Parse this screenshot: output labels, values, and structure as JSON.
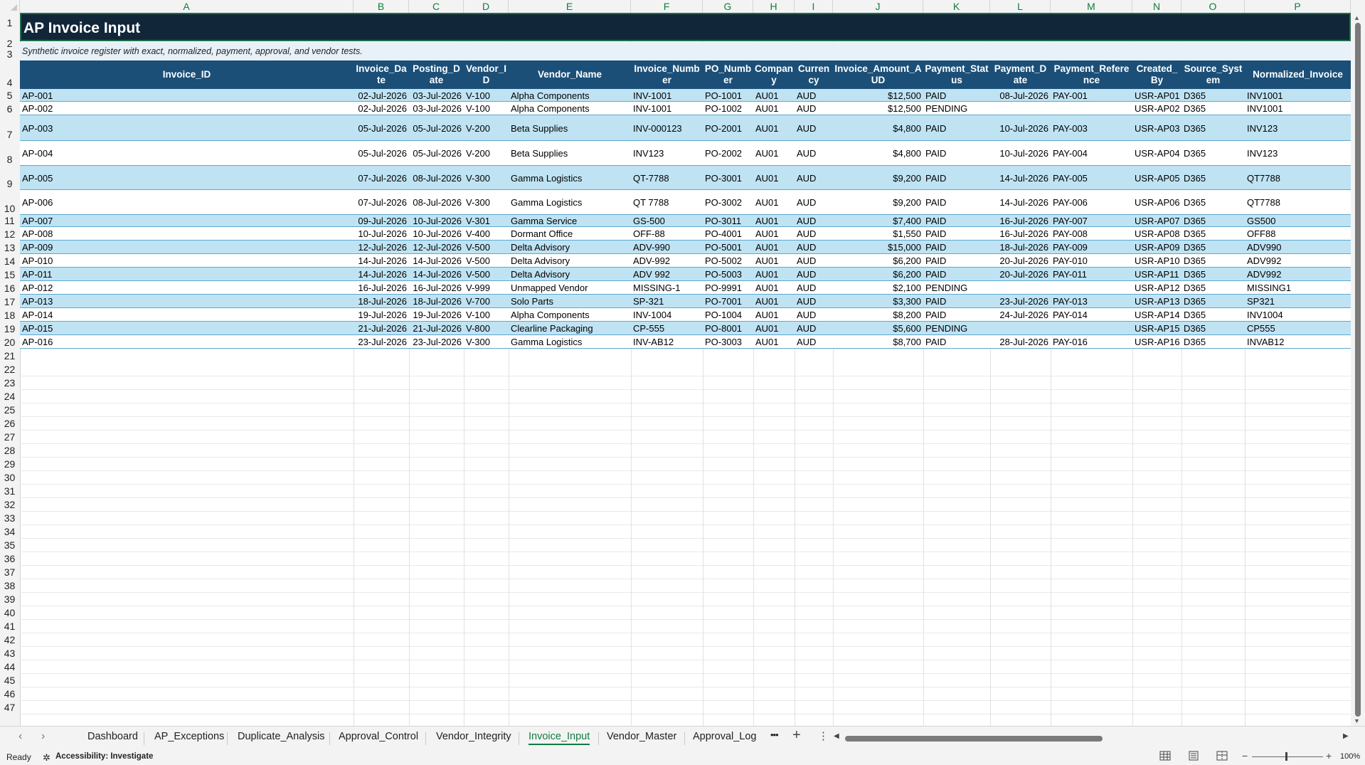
{
  "sheet": {
    "title": "AP Invoice Input",
    "subtitle": "Synthetic invoice register with exact, normalized, payment, approval, and vendor tests."
  },
  "column_letters": [
    "A",
    "B",
    "C",
    "D",
    "E",
    "F",
    "G",
    "H",
    "I",
    "J",
    "K",
    "L",
    "M",
    "N",
    "O",
    "P"
  ],
  "row_numbers": [
    "1",
    "2",
    "3",
    "4",
    "5",
    "6",
    "7",
    "8",
    "9",
    "10",
    "11",
    "12",
    "13",
    "14",
    "15",
    "16",
    "17",
    "18",
    "19",
    "20",
    "21",
    "22",
    "23",
    "24",
    "25",
    "26",
    "27",
    "28",
    "29",
    "30",
    "31",
    "32",
    "33",
    "34",
    "35",
    "36",
    "37",
    "38",
    "39",
    "40",
    "41",
    "42",
    "43",
    "44",
    "45",
    "46",
    "47"
  ],
  "table": {
    "headers": [
      "Invoice_ID",
      "Invoice_Date",
      "Posting_Date",
      "Vendor_ID",
      "Vendor_Name",
      "Invoice_Number",
      "PO_Number",
      "Company",
      "Currency",
      "Invoice_Amount_AUD",
      "Payment_Status",
      "Payment_Date",
      "Payment_Reference",
      "Created_By",
      "Source_System",
      "Normalized_Invoice"
    ],
    "rows": [
      [
        "AP-001",
        "02-Jul-2026",
        "03-Jul-2026",
        "V-100",
        "Alpha Components",
        "INV-1001",
        "PO-1001",
        "AU01",
        "AUD",
        "$12,500",
        "PAID",
        "08-Jul-2026",
        "PAY-001",
        "USR-AP01",
        "D365",
        "INV1001"
      ],
      [
        "AP-002",
        "02-Jul-2026",
        "03-Jul-2026",
        "V-100",
        "Alpha Components",
        "INV-1001",
        "PO-1002",
        "AU01",
        "AUD",
        "$12,500",
        "PENDING",
        "",
        "",
        "USR-AP02",
        "D365",
        "INV1001"
      ],
      [
        "AP-003",
        "05-Jul-2026",
        "05-Jul-2026",
        "V-200",
        "Beta Supplies",
        "INV-000123",
        "PO-2001",
        "AU01",
        "AUD",
        "$4,800",
        "PAID",
        "10-Jul-2026",
        "PAY-003",
        "USR-AP03",
        "D365",
        "INV123"
      ],
      [
        "AP-004",
        "05-Jul-2026",
        "05-Jul-2026",
        "V-200",
        "Beta Supplies",
        "INV123",
        "PO-2002",
        "AU01",
        "AUD",
        "$4,800",
        "PAID",
        "10-Jul-2026",
        "PAY-004",
        "USR-AP04",
        "D365",
        "INV123"
      ],
      [
        "AP-005",
        "07-Jul-2026",
        "08-Jul-2026",
        "V-300",
        "Gamma Logistics",
        "QT-7788",
        "PO-3001",
        "AU01",
        "AUD",
        "$9,200",
        "PAID",
        "14-Jul-2026",
        "PAY-005",
        "USR-AP05",
        "D365",
        "QT7788"
      ],
      [
        "AP-006",
        "07-Jul-2026",
        "08-Jul-2026",
        "V-300",
        "Gamma Logistics",
        "QT 7788",
        "PO-3002",
        "AU01",
        "AUD",
        "$9,200",
        "PAID",
        "14-Jul-2026",
        "PAY-006",
        "USR-AP06",
        "D365",
        "QT7788"
      ],
      [
        "AP-007",
        "09-Jul-2026",
        "10-Jul-2026",
        "V-301",
        "Gamma Service",
        "GS-500",
        "PO-3011",
        "AU01",
        "AUD",
        "$7,400",
        "PAID",
        "16-Jul-2026",
        "PAY-007",
        "USR-AP07",
        "D365",
        "GS500"
      ],
      [
        "AP-008",
        "10-Jul-2026",
        "10-Jul-2026",
        "V-400",
        "Dormant Office",
        "OFF-88",
        "PO-4001",
        "AU01",
        "AUD",
        "$1,550",
        "PAID",
        "16-Jul-2026",
        "PAY-008",
        "USR-AP08",
        "D365",
        "OFF88"
      ],
      [
        "AP-009",
        "12-Jul-2026",
        "12-Jul-2026",
        "V-500",
        "Delta Advisory",
        "ADV-990",
        "PO-5001",
        "AU01",
        "AUD",
        "$15,000",
        "PAID",
        "18-Jul-2026",
        "PAY-009",
        "USR-AP09",
        "D365",
        "ADV990"
      ],
      [
        "AP-010",
        "14-Jul-2026",
        "14-Jul-2026",
        "V-500",
        "Delta Advisory",
        "ADV-992",
        "PO-5002",
        "AU01",
        "AUD",
        "$6,200",
        "PAID",
        "20-Jul-2026",
        "PAY-010",
        "USR-AP10",
        "D365",
        "ADV992"
      ],
      [
        "AP-011",
        "14-Jul-2026",
        "14-Jul-2026",
        "V-500",
        "Delta Advisory",
        "ADV 992",
        "PO-5003",
        "AU01",
        "AUD",
        "$6,200",
        "PAID",
        "20-Jul-2026",
        "PAY-011",
        "USR-AP11",
        "D365",
        "ADV992"
      ],
      [
        "AP-012",
        "16-Jul-2026",
        "16-Jul-2026",
        "V-999",
        "Unmapped Vendor",
        "MISSING-1",
        "PO-9991",
        "AU01",
        "AUD",
        "$2,100",
        "PENDING",
        "",
        "",
        "USR-AP12",
        "D365",
        "MISSING1"
      ],
      [
        "AP-013",
        "18-Jul-2026",
        "18-Jul-2026",
        "V-700",
        "Solo Parts",
        "SP-321",
        "PO-7001",
        "AU01",
        "AUD",
        "$3,300",
        "PAID",
        "23-Jul-2026",
        "PAY-013",
        "USR-AP13",
        "D365",
        "SP321"
      ],
      [
        "AP-014",
        "19-Jul-2026",
        "19-Jul-2026",
        "V-100",
        "Alpha Components",
        "INV-1004",
        "PO-1004",
        "AU01",
        "AUD",
        "$8,200",
        "PAID",
        "24-Jul-2026",
        "PAY-014",
        "USR-AP14",
        "D365",
        "INV1004"
      ],
      [
        "AP-015",
        "21-Jul-2026",
        "21-Jul-2026",
        "V-800",
        "Clearline Packaging",
        "CP-555",
        "PO-8001",
        "AU01",
        "AUD",
        "$5,600",
        "PENDING",
        "",
        "",
        "USR-AP15",
        "D365",
        "CP555"
      ],
      [
        "AP-016",
        "23-Jul-2026",
        "23-Jul-2026",
        "V-300",
        "Gamma Logistics",
        "INV-AB12",
        "PO-3003",
        "AU01",
        "AUD",
        "$8,700",
        "PAID",
        "28-Jul-2026",
        "PAY-016",
        "USR-AP16",
        "D365",
        "INVAB12"
      ]
    ]
  },
  "sheet_tabs": [
    "Dashboard",
    "AP_Exceptions",
    "Duplicate_Analysis",
    "Approval_Control",
    "Vendor_Integrity",
    "Invoice_Input",
    "Vendor_Master",
    "Approval_Log"
  ],
  "active_tab": "Invoice_Input",
  "tab_more_label": "•••",
  "status": {
    "ready": "Ready",
    "accessibility": "Accessibility: Investigate",
    "zoom": "100%"
  },
  "colors": {
    "title_bg": "#12263a",
    "header_bg": "#1b4f78",
    "band_row": "#bfe3f3",
    "accent": "#107c41"
  },
  "icons": [
    "triangle-corner-icon",
    "chevron-left-icon",
    "chevron-right-icon",
    "plus-icon",
    "more-vert-icon",
    "normal-view-icon",
    "page-layout-icon",
    "page-break-icon",
    "accessibility-icon"
  ]
}
